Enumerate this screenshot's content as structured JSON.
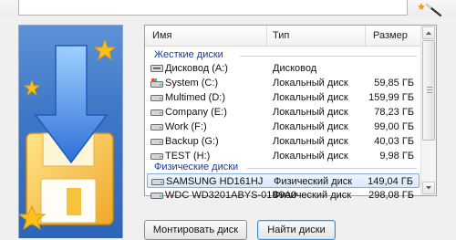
{
  "list": {
    "columns": {
      "name": "Имя",
      "type": "Тип",
      "size": "Размер"
    },
    "groups": [
      {
        "label": "Жесткие диски",
        "rows": [
          {
            "name": "Дисковод (A:)",
            "type": "Дисковод",
            "size": "",
            "icon": "floppy-drive-icon"
          },
          {
            "name": "System (C:)",
            "type": "Локальный диск",
            "size": "59,85 ГБ",
            "icon": "system-drive-icon"
          },
          {
            "name": "Multimed (D:)",
            "type": "Локальный диск",
            "size": "159,99 ГБ",
            "icon": "hard-drive-icon"
          },
          {
            "name": "Company (E:)",
            "type": "Локальный диск",
            "size": "78,23 ГБ",
            "icon": "hard-drive-icon"
          },
          {
            "name": "Work (F:)",
            "type": "Локальный диск",
            "size": "99,00 ГБ",
            "icon": "hard-drive-icon"
          },
          {
            "name": "Backup (G:)",
            "type": "Локальный диск",
            "size": "40,03 ГБ",
            "icon": "hard-drive-icon"
          },
          {
            "name": "TEST (H:)",
            "type": "Локальный диск",
            "size": "9,98 ГБ",
            "icon": "hard-drive-icon"
          }
        ]
      },
      {
        "label": "Физические диски",
        "rows": [
          {
            "name": "SAMSUNG HD161HJ",
            "type": "Физический диск",
            "size": "149,04 ГБ",
            "icon": "hard-drive-icon",
            "selected": true
          },
          {
            "name": "WDC WD3201ABYS-01B9A0",
            "type": "Физический диск",
            "size": "298,08 ГБ",
            "icon": "hard-drive-icon"
          }
        ]
      }
    ]
  },
  "buttons": {
    "mount": "Монтировать диск",
    "find": "Найти диски"
  },
  "colors": {
    "panel_blue": "#3e78c7",
    "arrow_blue": "#3b7fe0",
    "floppy_yellow": "#f6c33d",
    "star_yellow": "#f7c21c",
    "group_text": "#1a3b9e",
    "selection": "#d9e8fb"
  }
}
